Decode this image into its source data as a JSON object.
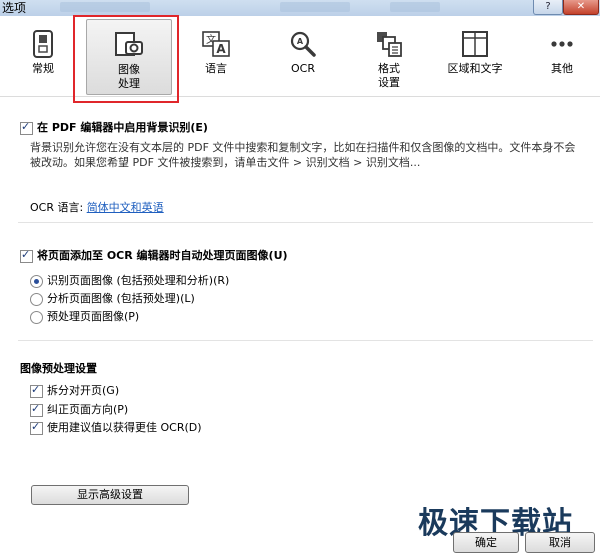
{
  "window": {
    "title": "选项",
    "help_label": "?",
    "close_label": "✕"
  },
  "toolbar": {
    "items": [
      {
        "label": "常规",
        "icon": "switch-icon"
      },
      {
        "label": "图像\n处理",
        "icon": "image-camera-icon",
        "selected": true
      },
      {
        "label": "语言",
        "icon": "language-icon"
      },
      {
        "label": "OCR",
        "icon": "ocr-magnifier-icon"
      },
      {
        "label": "格式\n设置",
        "icon": "format-icon"
      },
      {
        "label": "区域和文字",
        "icon": "regions-icon"
      },
      {
        "label": "其他",
        "icon": "more-icon"
      }
    ]
  },
  "background_recognition": {
    "checkbox_label": "在 PDF 编辑器中启用背景识别(E)",
    "checked": true,
    "description": "背景识别允许您在没有文本层的 PDF 文件中搜索和复制文字，比如在扫描件和仅含图像的文档中。文件本身不会被改动。如果您希望 PDF 文件被搜索到，请单击文件 > 识别文档 > 识别文档...",
    "ocr_language_label": "OCR 语言:",
    "ocr_language_link": "简体中文和英语"
  },
  "auto_process": {
    "checkbox_label": "将页面添加至 OCR 编辑器时自动处理页面图像(U)",
    "checked": true,
    "options": [
      {
        "label": "识别页面图像 (包括预处理和分析)(R)",
        "selected": true
      },
      {
        "label": "分析页面图像 (包括预处理)(L)",
        "selected": false
      },
      {
        "label": "预处理页面图像(P)",
        "selected": false
      }
    ]
  },
  "preprocess": {
    "heading": "图像预处理设置",
    "options": [
      {
        "label": "拆分对开页(G)",
        "checked": true
      },
      {
        "label": "纠正页面方向(P)",
        "checked": true
      },
      {
        "label": "使用建议值以获得更佳 OCR(D)",
        "checked": true
      }
    ],
    "advanced_button": "显示高级设置"
  },
  "footer": {
    "ok_label": "确定",
    "cancel_label": "取消"
  },
  "watermark": "极速下载站"
}
